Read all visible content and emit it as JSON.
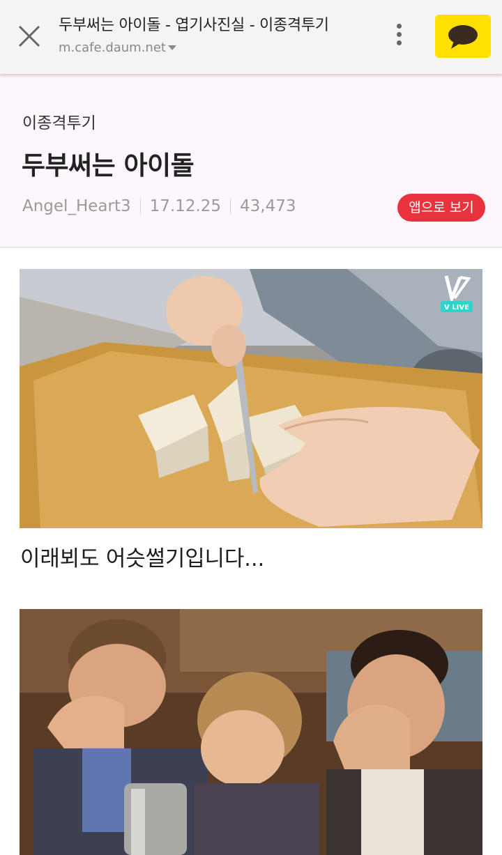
{
  "browser": {
    "page_title": "두부써는 아이돌 - 엽기사진실 - 이종격투기",
    "url": "m.cafe.daum.net"
  },
  "article": {
    "board": "이종격투기",
    "title": "두부써는 아이돌",
    "author": "Angel_Heart3",
    "date": "17.12.25",
    "views": "43,473",
    "app_button": "앱으로 보기"
  },
  "content": {
    "caption": "이래뵈도 어슷썰기입니다...",
    "vlive_badge": "V LIVE"
  },
  "icons": {
    "close": "close-icon",
    "more": "more-vert-icon",
    "kakao": "kakaotalk-share-icon"
  },
  "colors": {
    "kakao_yellow": "#ffe000",
    "app_button_red": "#e8333e",
    "vlive_teal": "#2ed3c9"
  }
}
